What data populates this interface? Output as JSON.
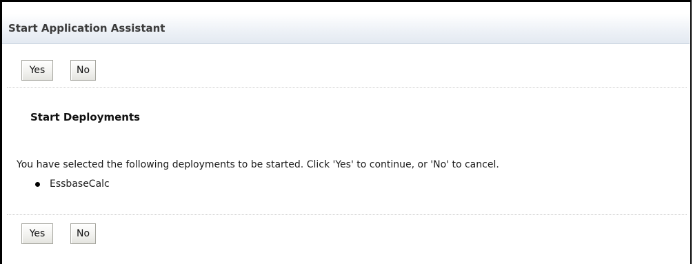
{
  "header": {
    "title": "Start Application Assistant"
  },
  "top_buttons": {
    "yes_label": "Yes",
    "no_label": "No"
  },
  "section": {
    "title": "Start Deployments"
  },
  "message": "You have selected the following deployments to be started. Click 'Yes' to continue, or 'No' to cancel.",
  "deployments": [
    "EssbaseCalc"
  ],
  "bottom_buttons": {
    "yes_label": "Yes",
    "no_label": "No"
  }
}
